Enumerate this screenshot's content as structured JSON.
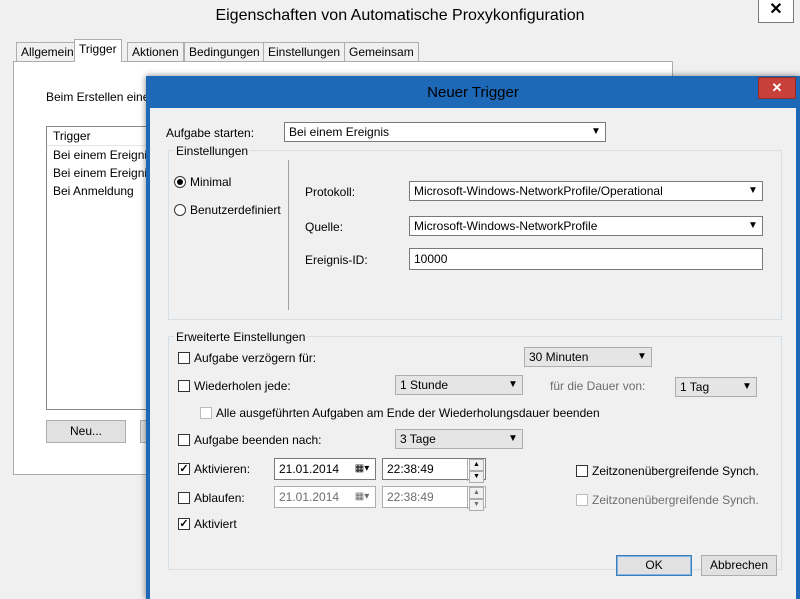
{
  "back_window": {
    "title": "Eigenschaften von Automatische Proxykonfiguration",
    "close_glyph": "✕",
    "tabs": [
      "Allgemein",
      "Trigger",
      "Aktionen",
      "Bedingungen",
      "Einstellungen",
      "Gemeinsam"
    ],
    "active_tab": "Trigger",
    "description": "Beim Erstellen einer",
    "list_header": "Trigger",
    "list_items": [
      "Bei einem Ereignis",
      "Bei einem Ereignis",
      "Bei Anmeldung"
    ],
    "new_button": "Neu..."
  },
  "dialog": {
    "title": "Neuer Trigger",
    "close_glyph": "✕",
    "start_task_label": "Aufgabe starten:",
    "start_task_value": "Bei einem Ereignis",
    "settings_group": "Einstellungen",
    "radio_minimal": "Minimal",
    "radio_custom": "Benutzerdefiniert",
    "log_label": "Protokoll:",
    "log_value": "Microsoft-Windows-NetworkProfile/Operational",
    "source_label": "Quelle:",
    "source_value": "Microsoft-Windows-NetworkProfile",
    "event_id_label": "Ereignis-ID:",
    "event_id_value": "10000",
    "advanced_group": "Erweiterte Einstellungen",
    "delay_label": "Aufgabe verzögern für:",
    "delay_value": "30 Minuten",
    "repeat_label": "Wiederholen jede:",
    "repeat_value": "1 Stunde",
    "duration_label": "für die Dauer von:",
    "duration_value": "1 Tag",
    "stop_all_label": "Alle ausgeführten Aufgaben am Ende der Wiederholungsdauer beenden",
    "stop_after_label": "Aufgabe beenden nach:",
    "stop_after_value": "3 Tage",
    "activate_label": "Aktivieren:",
    "activate_date": "21.01.2014",
    "activate_time": "22:38:49",
    "activate_sync": "Zeitzonenübergreifende Synch.",
    "expire_label": "Ablaufen:",
    "expire_date": "21.01.2014",
    "expire_time": "22:38:49",
    "expire_sync": "Zeitzonenübergreifende Synch.",
    "enabled_label": "Aktiviert",
    "ok_button": "OK",
    "cancel_button": "Abbrechen",
    "checked_glyph": "✓",
    "dropdown_glyph": "▼",
    "up_glyph": "▲",
    "down_glyph": "▼",
    "calendar_glyph": "▦▾"
  },
  "state": {
    "radio_minimal_selected": true,
    "delay_checked": false,
    "repeat_checked": false,
    "stop_all_checked": false,
    "stop_after_checked": false,
    "activate_checked": true,
    "activate_sync_checked": false,
    "expire_checked": false,
    "expire_sync_checked": false,
    "enabled_checked": true
  },
  "colors": {
    "dialog_frame": "#1d68b7",
    "close_button": "#c7413a",
    "window_bg": "#f0f0f0"
  }
}
